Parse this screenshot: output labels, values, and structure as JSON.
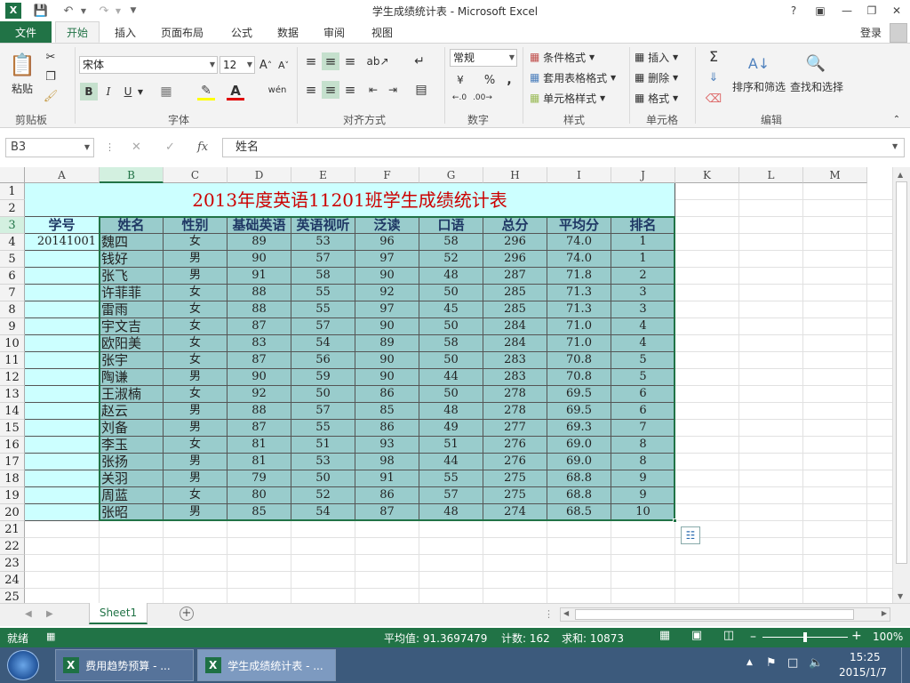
{
  "window": {
    "title": "学生成绩统计表 - Microsoft Excel",
    "help": "?",
    "signin": "登录"
  },
  "tabs": [
    "文件",
    "开始",
    "插入",
    "页面布局",
    "公式",
    "数据",
    "审阅",
    "视图"
  ],
  "ribbon": {
    "clipboard": {
      "paste": "粘贴",
      "group": "剪贴板"
    },
    "font": {
      "name": "宋体",
      "size": "12",
      "bold": "B",
      "italic": "I",
      "underline": "U",
      "wen": "wén",
      "group": "字体"
    },
    "align": {
      "group": "对齐方式"
    },
    "number": {
      "format": "常规",
      "percent": "%",
      "comma": ",",
      "group": "数字"
    },
    "styles": {
      "cond": "条件格式",
      "table": "套用表格格式",
      "cellstyle": "单元格样式",
      "group": "样式"
    },
    "cells": {
      "insert": "插入",
      "delete": "删除",
      "format": "格式",
      "group": "单元格"
    },
    "editing": {
      "sort": "排序和筛选",
      "find": "查找和选择",
      "group": "编辑"
    }
  },
  "formula_bar": {
    "name_box": "B3",
    "fx": "fx",
    "content": "姓名"
  },
  "columns": [
    "A",
    "B",
    "C",
    "D",
    "E",
    "F",
    "G",
    "H",
    "I",
    "J",
    "K",
    "L",
    "M"
  ],
  "sheet": {
    "title": "2013年度英语11201班学生成绩统计表",
    "headers": [
      "学号",
      "姓名",
      "性别",
      "基础英语",
      "英语视听",
      "泛读",
      "口语",
      "总分",
      "平均分",
      "排名"
    ],
    "first_id": "20141001",
    "rows": [
      [
        "魏四",
        "女",
        "89",
        "53",
        "96",
        "58",
        "296",
        "74.0",
        "1"
      ],
      [
        "钱好",
        "男",
        "90",
        "57",
        "97",
        "52",
        "296",
        "74.0",
        "1"
      ],
      [
        "张飞",
        "男",
        "91",
        "58",
        "90",
        "48",
        "287",
        "71.8",
        "2"
      ],
      [
        "许菲菲",
        "女",
        "88",
        "55",
        "92",
        "50",
        "285",
        "71.3",
        "3"
      ],
      [
        "雷雨",
        "女",
        "88",
        "55",
        "97",
        "45",
        "285",
        "71.3",
        "3"
      ],
      [
        "宇文吉",
        "女",
        "87",
        "57",
        "90",
        "50",
        "284",
        "71.0",
        "4"
      ],
      [
        "欧阳美",
        "女",
        "83",
        "54",
        "89",
        "58",
        "284",
        "71.0",
        "4"
      ],
      [
        "张宇",
        "女",
        "87",
        "56",
        "90",
        "50",
        "283",
        "70.8",
        "5"
      ],
      [
        "陶谦",
        "男",
        "90",
        "59",
        "90",
        "44",
        "283",
        "70.8",
        "5"
      ],
      [
        "王淑楠",
        "女",
        "92",
        "50",
        "86",
        "50",
        "278",
        "69.5",
        "6"
      ],
      [
        "赵云",
        "男",
        "88",
        "57",
        "85",
        "48",
        "278",
        "69.5",
        "6"
      ],
      [
        "刘备",
        "男",
        "87",
        "55",
        "86",
        "49",
        "277",
        "69.3",
        "7"
      ],
      [
        "李玉",
        "女",
        "81",
        "51",
        "93",
        "51",
        "276",
        "69.0",
        "8"
      ],
      [
        "张扬",
        "男",
        "81",
        "53",
        "98",
        "44",
        "276",
        "69.0",
        "8"
      ],
      [
        "关羽",
        "男",
        "79",
        "50",
        "91",
        "55",
        "275",
        "68.8",
        "9"
      ],
      [
        "周蓝",
        "女",
        "80",
        "52",
        "86",
        "57",
        "275",
        "68.8",
        "9"
      ],
      [
        "张昭",
        "男",
        "85",
        "54",
        "87",
        "48",
        "274",
        "68.5",
        "10"
      ]
    ],
    "row_numbers": [
      "1",
      "2",
      "3",
      "4",
      "5",
      "6",
      "7",
      "8",
      "9",
      "10",
      "11",
      "12",
      "13",
      "14",
      "15",
      "16",
      "17",
      "18",
      "19",
      "20",
      "21",
      "22",
      "23",
      "24",
      "25"
    ]
  },
  "sheet_tab": "Sheet1",
  "status": {
    "ready": "就绪",
    "average": "平均值: 91.3697479",
    "count": "计数: 162",
    "sum": "求和: 10873",
    "zoom": "100%"
  },
  "taskbar": {
    "task1": "费用趋势预算 - ...",
    "task2": "学生成绩统计表 - ...",
    "time": "15:25",
    "date": "2015/1/7"
  },
  "colors": {
    "accent": "#217346",
    "title_fill": "#ccffff",
    "data_fill": "#99cccc",
    "title_text": "#cc0000",
    "header_text": "#1f3864"
  }
}
